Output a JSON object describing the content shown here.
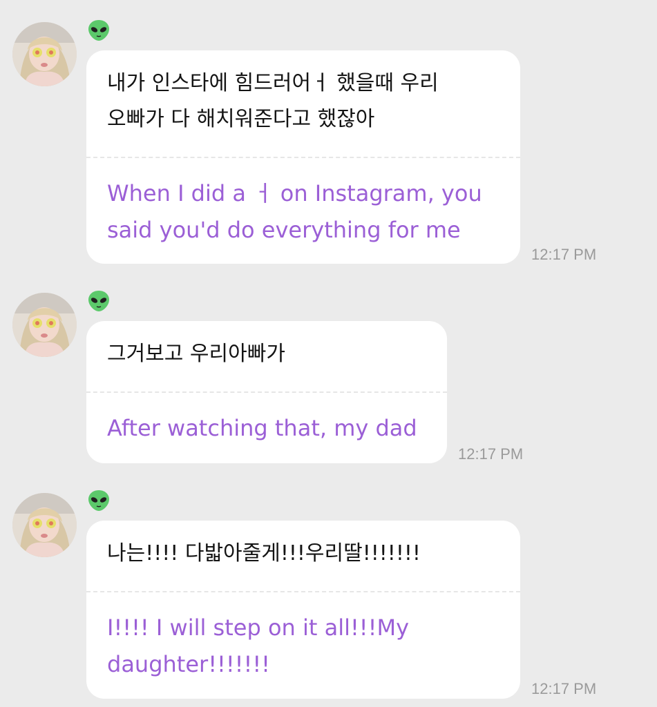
{
  "messages": [
    {
      "sender_icon": "alien-emoji-icon",
      "original": "내가 인스타에 힘드러어ㅓ 했을때 우리\n오빠가 다 해치워준다고 했잖아",
      "translation": "When I did a ㅓ on Instagram, you\nsaid you'd do everything for me",
      "time": "12:17 PM"
    },
    {
      "sender_icon": "alien-emoji-icon",
      "original": "그거보고 우리아빠가",
      "translation": "After watching that, my dad",
      "time": "12:17 PM"
    },
    {
      "sender_icon": "alien-emoji-icon",
      "original": "나는!!!! 다밟아줄게!!!우리딸!!!!!!!",
      "translation": "I!!!! I will step on it all!!!My\ndaughter!!!!!!!",
      "time": "12:17 PM"
    }
  ],
  "colors": {
    "background": "#ebebeb",
    "bubble": "#ffffff",
    "translation_text": "#9b5fd6",
    "original_text": "#141414",
    "timestamp": "#9a9a9a"
  }
}
